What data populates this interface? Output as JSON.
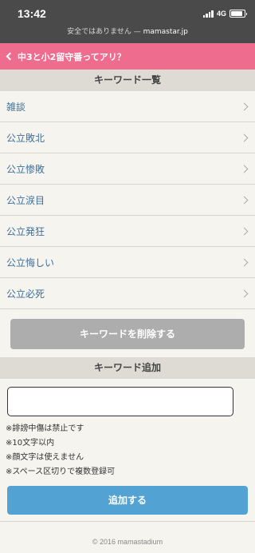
{
  "status_bar": {
    "time": "13:42",
    "network": "4G",
    "battery_level": 0.9
  },
  "url_bar": {
    "warning": "安全ではありません — ",
    "domain": "mamastar.jp"
  },
  "nav": {
    "back_label": "中3と小2留守番ってアリ？"
  },
  "keyword_section": {
    "title": "キーワード一覧",
    "items": [
      {
        "label": "雑談"
      },
      {
        "label": "公立敗北"
      },
      {
        "label": "公立惨敗"
      },
      {
        "label": "公立涙目"
      },
      {
        "label": "公立発狂"
      },
      {
        "label": "公立悔しい"
      },
      {
        "label": "公立必死"
      }
    ],
    "delete_label": "キーワードを削除する"
  },
  "add_section": {
    "title": "キーワード追加",
    "input_value": "",
    "rules": [
      "※誹謗中傷は禁止です",
      "※10文字以内",
      "※顔文字は使えません",
      "※スペース区切りで複数登録可"
    ],
    "add_label": "追加する"
  },
  "footer": {
    "copyright": "© 2016 mamastadium"
  }
}
